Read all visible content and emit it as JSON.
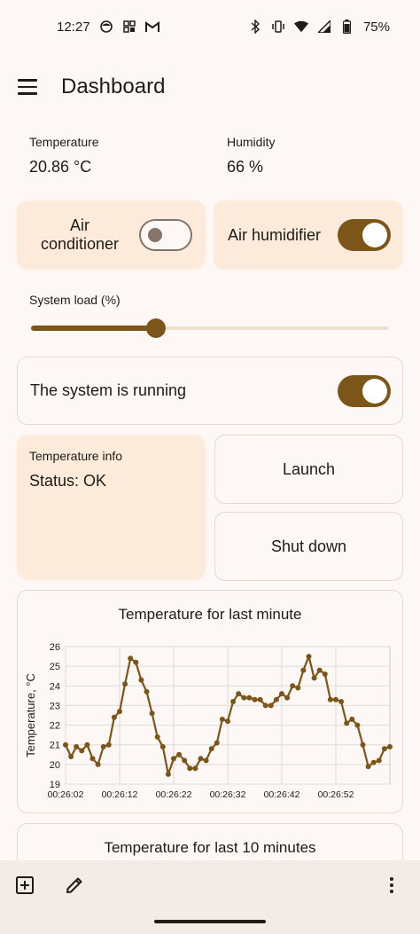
{
  "status_bar": {
    "time": "12:27",
    "battery": "75%"
  },
  "app": {
    "title": "Dashboard"
  },
  "readings": {
    "temperature": {
      "label": "Temperature",
      "value": "20.86 °C"
    },
    "humidity": {
      "label": "Humidity",
      "value": "66 %"
    }
  },
  "toggles": {
    "air_conditioner": {
      "label_line1": "Air",
      "label_line2": "conditioner",
      "state": "off"
    },
    "air_humidifier": {
      "label": "Air humidifier",
      "state": "on"
    }
  },
  "system_load": {
    "label": "System load (%)",
    "value_fraction": 0.35
  },
  "system_running": {
    "label": "The system is running",
    "state": "on"
  },
  "temperature_info": {
    "title": "Temperature info",
    "status": "Status: OK"
  },
  "buttons": {
    "launch": "Launch",
    "shut_down": "Shut down"
  },
  "colors": {
    "accent": "#7c5518",
    "card": "#fcebdb",
    "background": "#fdf8f5"
  },
  "chart_data": [
    {
      "type": "line",
      "title": "Temperature for last minute",
      "ylabel": "Temperature, °C",
      "xlabel": "",
      "ylim": [
        19,
        26
      ],
      "yticks": [
        19,
        20,
        21,
        22,
        23,
        24,
        25,
        26
      ],
      "xtick_labels": [
        "00:26:02",
        "00:26:12",
        "00:26:22",
        "00:26:32",
        "00:26:42",
        "00:26:52"
      ],
      "grid": true,
      "series": [
        {
          "values": [
            21.0,
            20.4,
            20.9,
            20.7,
            21.0,
            20.3,
            20.0,
            20.9,
            21.0,
            22.4,
            22.7,
            24.1,
            25.4,
            25.2,
            24.3,
            23.7,
            22.6,
            21.4,
            20.9,
            19.5,
            20.3,
            20.5,
            20.2,
            19.8,
            19.8,
            20.3,
            20.2,
            20.8,
            21.1,
            22.3,
            22.2,
            23.2,
            23.6,
            23.4,
            23.4,
            23.3,
            23.3,
            23.0,
            23.0,
            23.3,
            23.6,
            23.4,
            24.0,
            23.9,
            24.8,
            25.5,
            24.4,
            24.8,
            24.6,
            23.3,
            23.3,
            23.2,
            22.1,
            22.3,
            22.0,
            21.0,
            19.9,
            20.1,
            20.2,
            20.8,
            20.9
          ]
        }
      ]
    },
    {
      "type": "line",
      "title": "Temperature for last 10 minutes"
    }
  ]
}
